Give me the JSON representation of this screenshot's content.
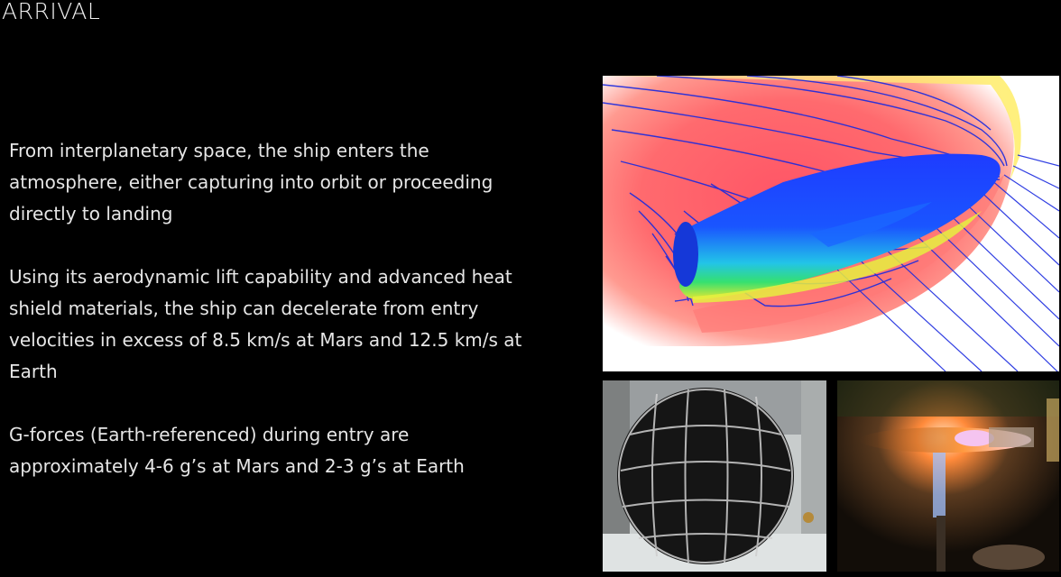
{
  "slide": {
    "title": "ARRIVAL"
  },
  "body": {
    "paragraphs": [
      "From interplanetary space, the ship enters the atmosphere, either capturing into orbit or proceeding directly to landing",
      "Using its aerodynamic lift capability and advanced heat shield materials, the ship can decelerate from entry velocities in excess of 8.5 km/s at Mars and 12.5 km/s at Earth",
      "G-forces (Earth-referenced) during entry are approximately 4-6 g’s at Mars and 2-3 g’s at Earth"
    ]
  }
}
